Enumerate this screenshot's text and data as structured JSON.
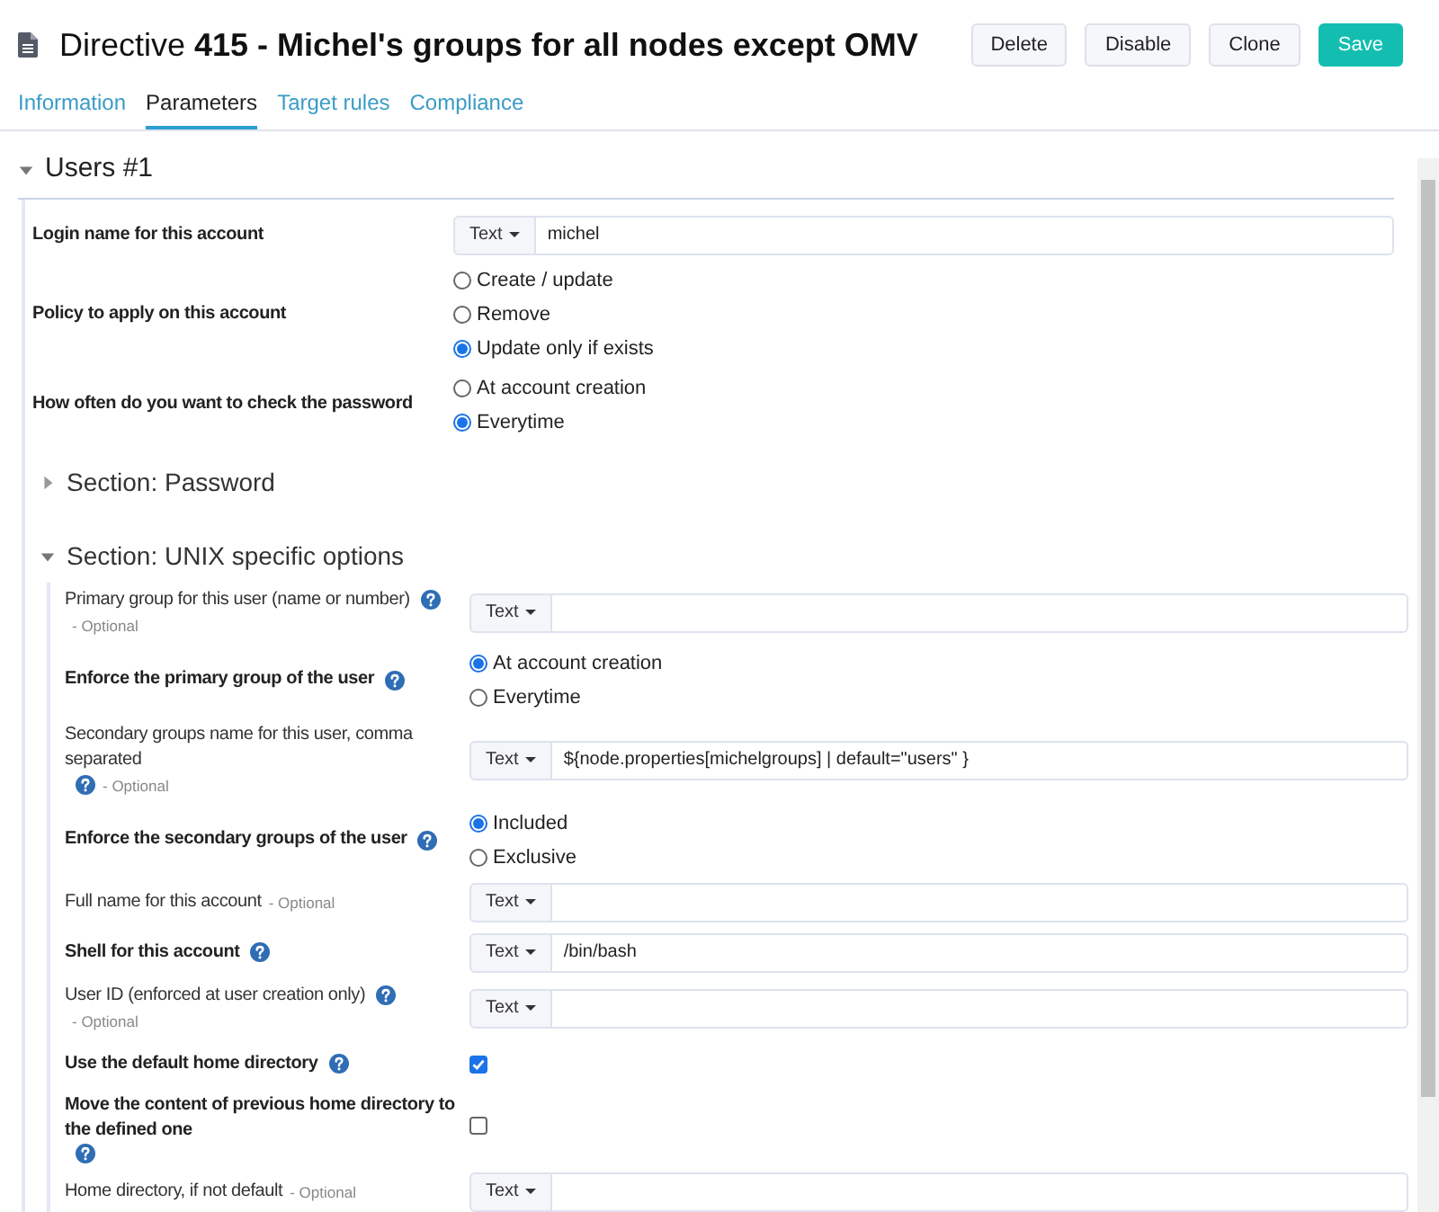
{
  "header": {
    "title": "Directive **415 - Michel's groups for all nodes except OMV**",
    "buttons": [
      {
        "label": "Delete",
        "kind": "default"
      },
      {
        "label": "Disable",
        "kind": "default"
      },
      {
        "label": "Clone",
        "kind": "default"
      },
      {
        "label": "Save",
        "kind": "primary"
      }
    ]
  },
  "tabs": [
    {
      "label": "Information",
      "selected": false
    },
    {
      "label": "Parameters",
      "selected": true
    },
    {
      "label": "Target rules",
      "selected": false
    },
    {
      "label": "Compliance",
      "selected": false
    }
  ],
  "section": {
    "title": "Users #1",
    "expanded": true,
    "fields": [
      {
        "kind": "text",
        "label": "Login name for this account",
        "type": "Text",
        "value": "michel"
      },
      {
        "kind": "radio",
        "label": "Policy to apply on this account",
        "options": [
          {
            "label": "Create / update",
            "selected": false
          },
          {
            "label": "Remove",
            "selected": false
          },
          {
            "label": "Update only if exists",
            "selected": true
          }
        ]
      },
      {
        "kind": "radio",
        "label": "How often do you want to check the password",
        "options": [
          {
            "label": "At account creation",
            "selected": false
          },
          {
            "label": "Everytime",
            "selected": true
          }
        ]
      }
    ],
    "subsections": [
      {
        "title": "Section: Password",
        "expanded": false
      },
      {
        "title": "Section: UNIX specific options",
        "expanded": true,
        "fields": [
          {
            "kind": "text",
            "label": "Primary group for this user (name or number)",
            "help": true,
            "optional": "- Optional",
            "type": "Text"
          },
          {
            "kind": "radio",
            "label": "Enforce the primary group of the user",
            "help": true,
            "options": [
              {
                "label": "At account creation",
                "selected": true
              },
              {
                "label": "Everytime",
                "selected": false
              }
            ]
          },
          {
            "kind": "text",
            "label": "Secondary groups name for this user, comma separated",
            "help": true,
            "optional": "- Optional",
            "type": "Text",
            "value": "${node.properties[michelgroups] | default=\"users\" }"
          },
          {
            "kind": "radio",
            "label": "Enforce the secondary groups of the user",
            "help": true,
            "options": [
              {
                "label": "Included",
                "selected": true
              },
              {
                "label": "Exclusive",
                "selected": false
              }
            ]
          },
          {
            "kind": "text",
            "label": "Full name for this account",
            "optional": "- Optional",
            "type": "Text"
          },
          {
            "kind": "text",
            "label": "Shell for this account",
            "help": true,
            "type": "Text",
            "value": "/bin/bash"
          },
          {
            "kind": "text",
            "label": "User ID (enforced at user creation only)",
            "help": true,
            "optional": "- Optional",
            "type": "Text"
          },
          {
            "kind": "checkbox",
            "label": "Use the default home directory",
            "help": true,
            "checked": true
          },
          {
            "kind": "checkbox",
            "label": "Move the content of previous home directory to the defined one",
            "help": true,
            "checked": false
          },
          {
            "kind": "text",
            "label": "Home directory, if not default",
            "optional": "- Optional",
            "type": "Text"
          }
        ]
      }
    ]
  }
}
